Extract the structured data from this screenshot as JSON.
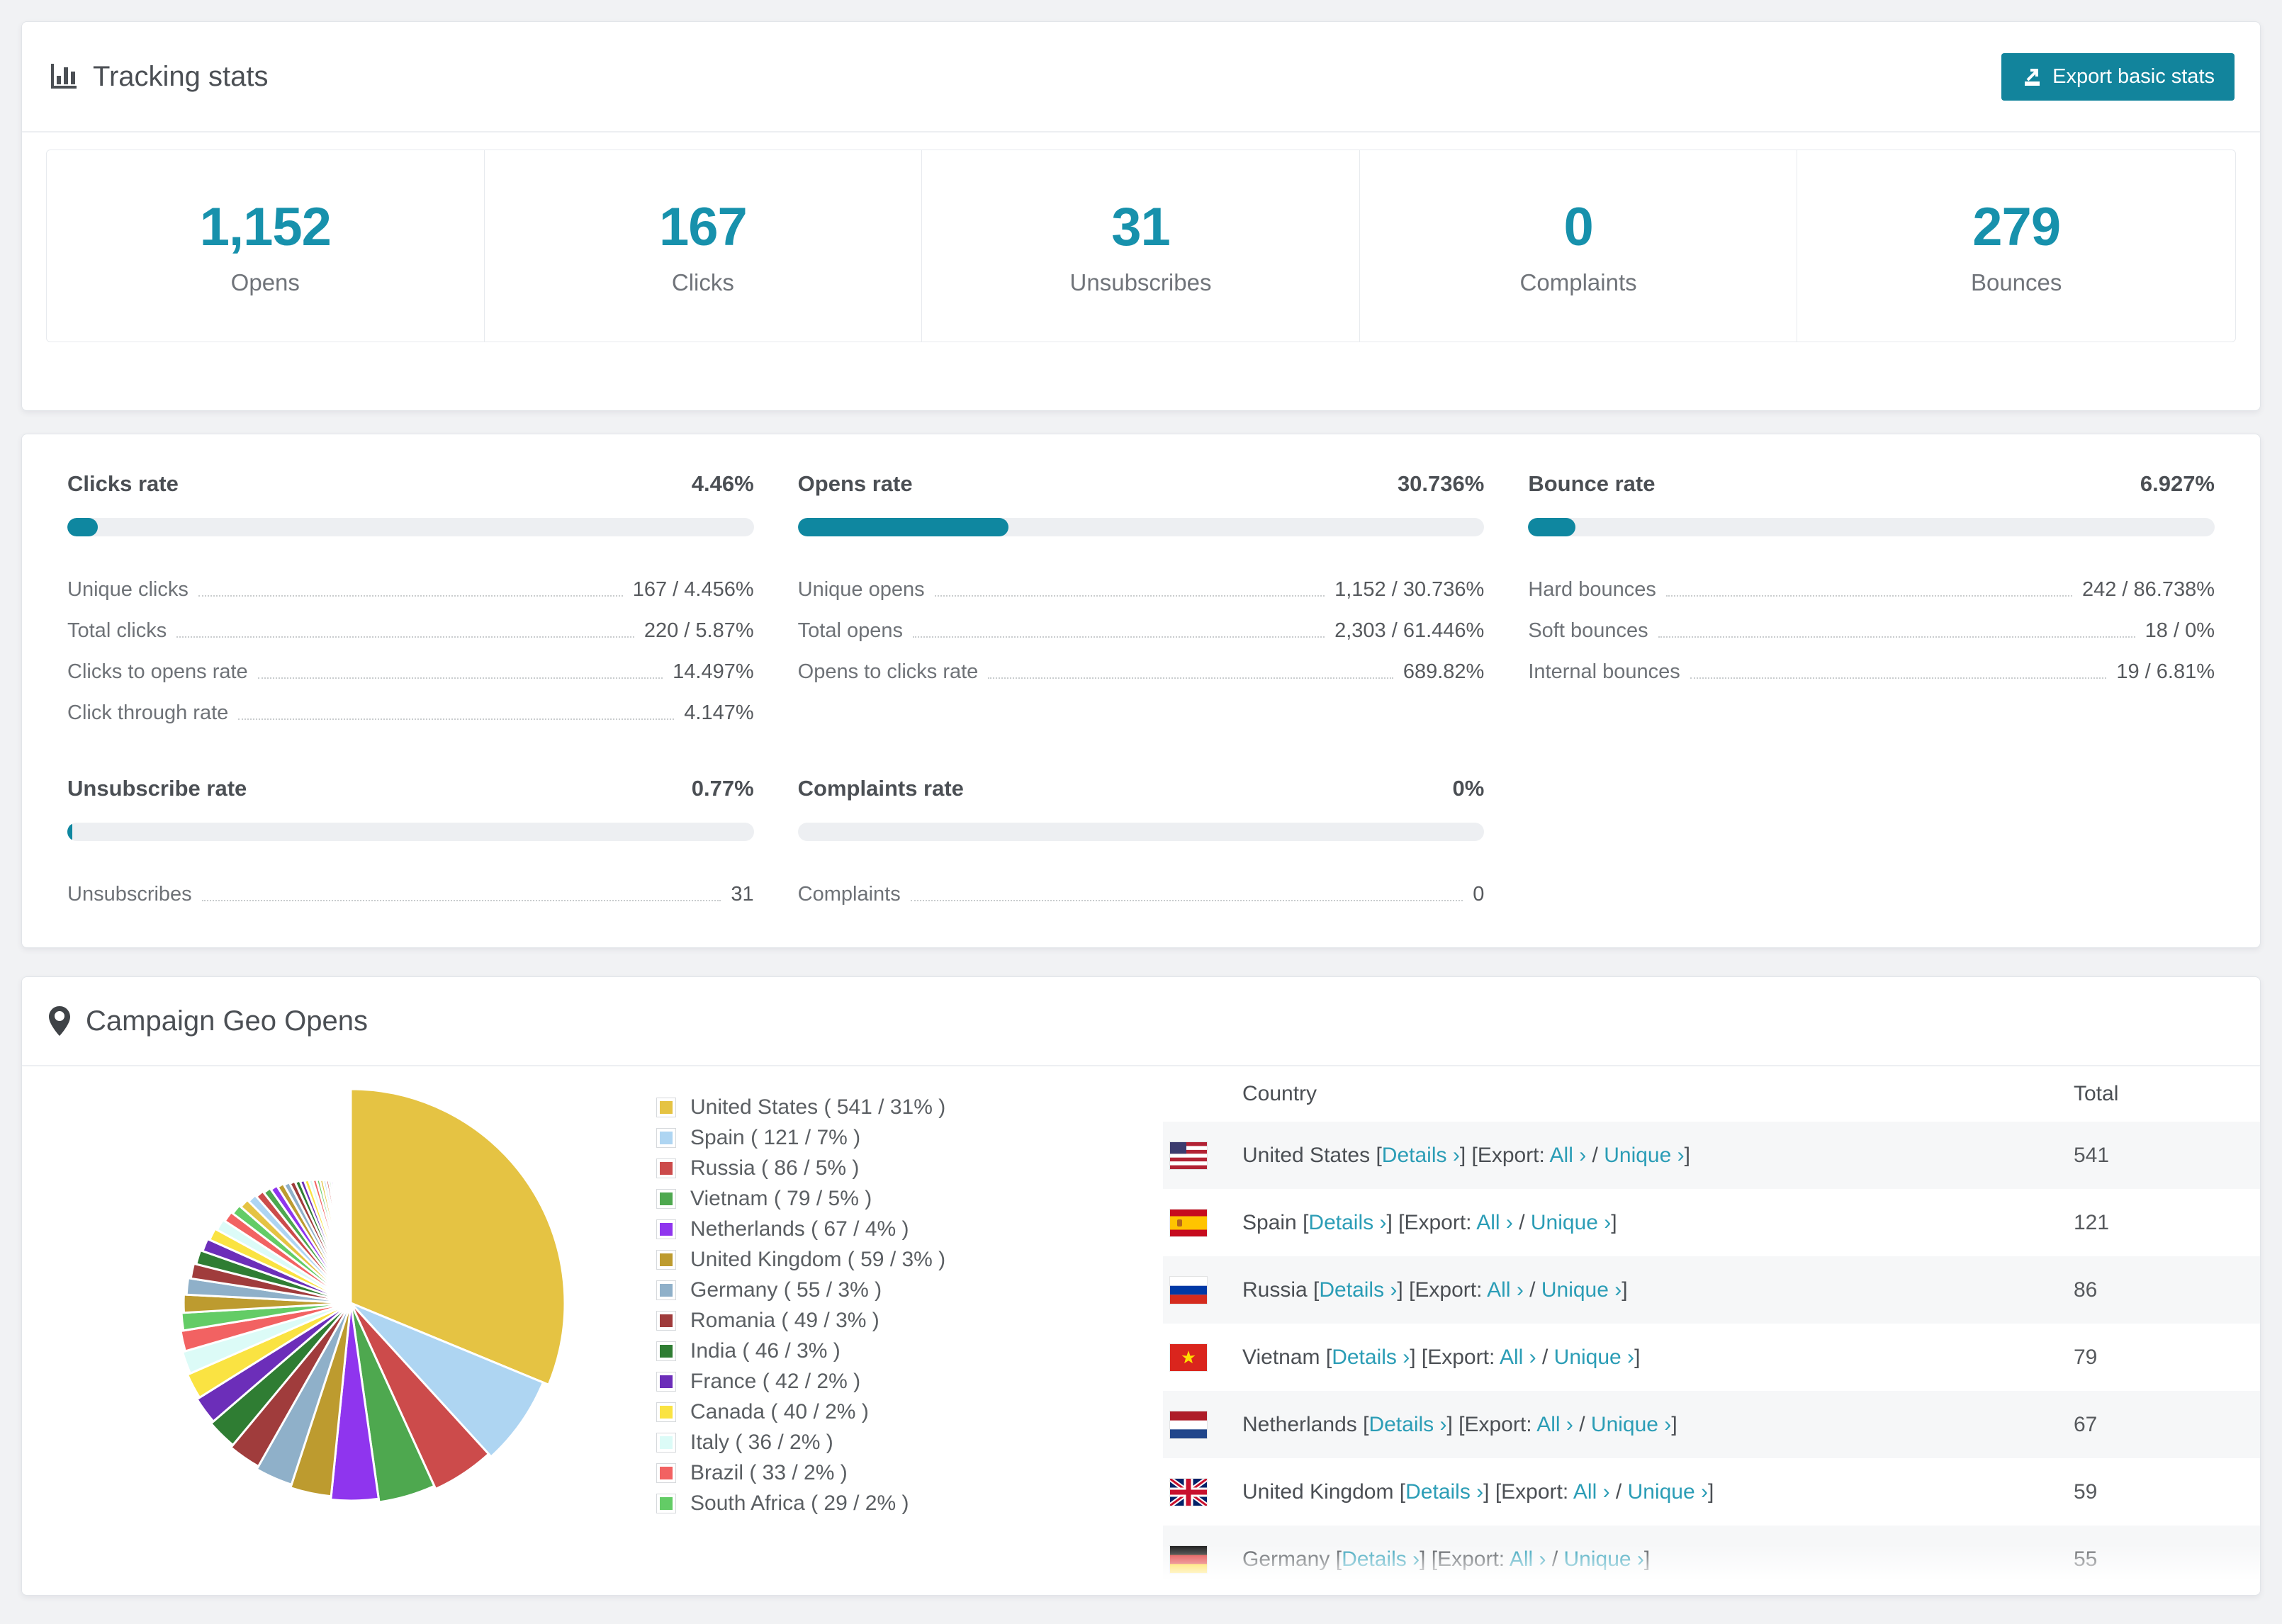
{
  "tracking": {
    "title": "Tracking stats",
    "export_button": "Export basic stats",
    "summary": [
      {
        "value": "1,152",
        "label": "Opens"
      },
      {
        "value": "167",
        "label": "Clicks"
      },
      {
        "value": "31",
        "label": "Unsubscribes"
      },
      {
        "value": "0",
        "label": "Complaints"
      },
      {
        "value": "279",
        "label": "Bounces"
      }
    ]
  },
  "rates": [
    {
      "id": "clicks-rate",
      "title": "Clicks rate",
      "value": "4.46%",
      "percent": 4.46,
      "rows": [
        [
          "Unique clicks",
          "167 / 4.456%"
        ],
        [
          "Total clicks",
          "220 / 5.87%"
        ],
        [
          "Clicks to opens rate",
          "14.497%"
        ],
        [
          "Click through rate",
          "4.147%"
        ]
      ]
    },
    {
      "id": "opens-rate",
      "title": "Opens rate",
      "value": "30.736%",
      "percent": 30.736,
      "rows": [
        [
          "Unique opens",
          "1,152 / 30.736%"
        ],
        [
          "Total opens",
          "2,303 / 61.446%"
        ],
        [
          "Opens to clicks rate",
          "689.82%"
        ]
      ]
    },
    {
      "id": "bounce-rate",
      "title": "Bounce rate",
      "value": "6.927%",
      "percent": 6.927,
      "rows": [
        [
          "Hard bounces",
          "242 / 86.738%"
        ],
        [
          "Soft bounces",
          "18 / 0%"
        ],
        [
          "Internal bounces",
          "19 / 6.81%"
        ]
      ]
    },
    {
      "id": "unsubscribe-rate",
      "title": "Unsubscribe rate",
      "value": "0.77%",
      "percent": 0.77,
      "rows": [
        [
          "Unsubscribes",
          "31"
        ]
      ]
    },
    {
      "id": "complaints-rate",
      "title": "Complaints rate",
      "value": "0%",
      "percent": 0,
      "rows": [
        [
          "Complaints",
          "0"
        ]
      ]
    }
  ],
  "geo": {
    "title": "Campaign Geo Opens",
    "table_headers": [
      "Country",
      "Total"
    ],
    "link_labels": {
      "details": "Details ›",
      "export_prefix": "Export:",
      "all": "All ›",
      "unique": "Unique ›",
      "open_bracket": "[",
      "close_bracket": "]",
      "slash": "/"
    },
    "rows": [
      {
        "country": "United States",
        "flag": "us",
        "total": "541"
      },
      {
        "country": "Spain",
        "flag": "es",
        "total": "121"
      },
      {
        "country": "Russia",
        "flag": "ru",
        "total": "86"
      },
      {
        "country": "Vietnam",
        "flag": "vn",
        "total": "79"
      },
      {
        "country": "Netherlands",
        "flag": "nl",
        "total": "67"
      },
      {
        "country": "United Kingdom",
        "flag": "gb",
        "total": "59"
      },
      {
        "country": "Germany",
        "flag": "de",
        "total": "55"
      }
    ]
  },
  "chart_data": {
    "type": "pie",
    "title": "Campaign Geo Opens",
    "legend_position": "right",
    "labels": [
      "United States",
      "Spain",
      "Russia",
      "Vietnam",
      "Netherlands",
      "United Kingdom",
      "Germany",
      "Romania",
      "India",
      "France",
      "Canada",
      "Italy",
      "Brazil",
      "South Africa"
    ],
    "values": [
      541,
      121,
      86,
      79,
      67,
      59,
      55,
      49,
      46,
      42,
      40,
      36,
      33,
      29
    ],
    "percent_labels": [
      "31%",
      "7%",
      "5%",
      "5%",
      "4%",
      "3%",
      "3%",
      "3%",
      "3%",
      "2%",
      "2%",
      "2%",
      "2%",
      "2%"
    ],
    "colors": [
      "#e5c343",
      "#aed5f2",
      "#cc4b4b",
      "#4ea84f",
      "#8f35ee",
      "#bd9b2f",
      "#8fb0c9",
      "#a03c3c",
      "#2f7d33",
      "#6c2eb9",
      "#fae342",
      "#dcfbf7",
      "#f26262",
      "#63cc66"
    ],
    "others_tail_estimated": [
      30,
      28,
      26,
      25,
      23,
      22,
      21,
      20,
      19,
      18,
      17,
      16,
      15,
      14,
      13,
      12,
      11,
      10,
      9,
      9,
      8,
      8,
      7,
      7,
      6,
      6,
      5,
      5,
      4,
      4,
      3,
      3,
      3,
      2,
      2,
      2,
      2,
      2,
      1,
      1,
      1,
      1,
      1,
      1,
      1,
      1,
      1,
      1,
      1,
      1
    ]
  }
}
